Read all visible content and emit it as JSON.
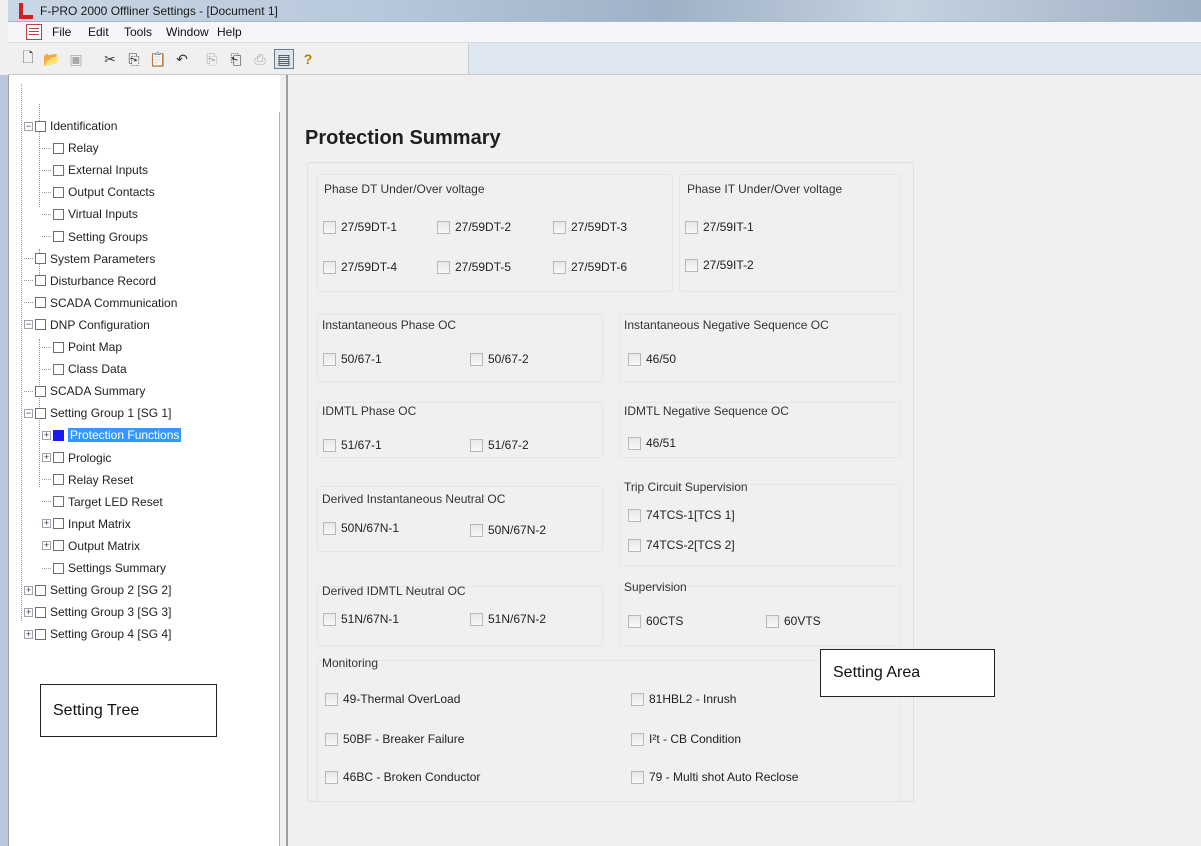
{
  "window": {
    "title": "F-PRO 2000 Offliner Settings - [Document 1]",
    "accent": "#d02020"
  },
  "menu": [
    "File",
    "Edit",
    "Tools",
    "Window",
    "Help"
  ],
  "toolbar": {
    "buttons": [
      "new-icon",
      "open-icon",
      "save-icon",
      "cut-icon",
      "copy-icon",
      "paste-icon",
      "undo-icon",
      "copy-disabled-icon",
      "compare-icon",
      "print-icon",
      "view-toggle-icon",
      "help-icon"
    ]
  },
  "tree": {
    "items": [
      {
        "label": "Identification",
        "level": 0,
        "expander": "minus"
      },
      {
        "label": "Relay",
        "level": 1
      },
      {
        "label": "External Inputs",
        "level": 1
      },
      {
        "label": "Output Contacts",
        "level": 1
      },
      {
        "label": "Virtual Inputs",
        "level": 1
      },
      {
        "label": "Setting Groups",
        "level": 1
      },
      {
        "label": "System Parameters",
        "level": 0
      },
      {
        "label": "Disturbance Record",
        "level": 0
      },
      {
        "label": "SCADA Communication",
        "level": 0
      },
      {
        "label": "DNP Configuration",
        "level": 0,
        "expander": "minus"
      },
      {
        "label": "Point Map",
        "level": 1
      },
      {
        "label": "Class Data",
        "level": 1
      },
      {
        "label": "SCADA Summary",
        "level": 0
      },
      {
        "label": "Setting Group 1 [SG 1]",
        "level": 0,
        "expander": "minus"
      },
      {
        "label": "Protection Functions",
        "level": 1,
        "expander": "plus",
        "selected": true
      },
      {
        "label": "Prologic",
        "level": 1,
        "expander": "plus"
      },
      {
        "label": "Relay Reset",
        "level": 1
      },
      {
        "label": "Target LED Reset",
        "level": 1
      },
      {
        "label": "Input Matrix",
        "level": 1,
        "expander": "plus"
      },
      {
        "label": "Output Matrix",
        "level": 1,
        "expander": "plus"
      },
      {
        "label": "Settings Summary",
        "level": 1
      },
      {
        "label": "Setting Group 2 [SG 2]",
        "level": 0,
        "expander": "plus"
      },
      {
        "label": "Setting Group 3 [SG 3]",
        "level": 0,
        "expander": "plus"
      },
      {
        "label": "Setting Group 4 [SG 4]",
        "level": 0,
        "expander": "plus"
      }
    ],
    "selected_color": "#3399ff"
  },
  "main": {
    "title": "Protection Summary",
    "groups": {
      "phase_dt": {
        "title": "Phase DT Under/Over voltage",
        "items": [
          "27/59DT-1",
          "27/59DT-2",
          "27/59DT-3",
          "27/59DT-4",
          "27/59DT-5",
          "27/59DT-6"
        ]
      },
      "phase_it": {
        "title": "Phase IT Under/Over voltage",
        "items": [
          "27/59IT-1",
          "27/59IT-2"
        ]
      },
      "inst_phase": {
        "title": "Instantaneous Phase OC",
        "items": [
          "50/67-1",
          "50/67-2"
        ]
      },
      "inst_neg": {
        "title": "Instantaneous Negative Sequence OC",
        "items": [
          "46/50"
        ]
      },
      "idmtl_phase": {
        "title": "IDMTL Phase OC",
        "items": [
          "51/67-1",
          "51/67-2"
        ]
      },
      "idmtl_neg": {
        "title": "IDMTL Negative Sequence OC",
        "items": [
          "46/51"
        ]
      },
      "derived_inst": {
        "title": "Derived Instantaneous Neutral OC",
        "items": [
          "50N/67N-1",
          "50N/67N-2"
        ]
      },
      "trip_circuit": {
        "title": "Trip Circuit Supervision",
        "items": [
          "74TCS-1[TCS 1]",
          "74TCS-2[TCS 2]"
        ]
      },
      "derived_idmtl": {
        "title": "Derived IDMTL Neutral OC",
        "items": [
          "51N/67N-1",
          "51N/67N-2"
        ]
      },
      "supervision": {
        "title": "Supervision",
        "items": [
          "60CTS",
          "60VTS"
        ]
      },
      "monitoring": {
        "title": "Monitoring",
        "items": [
          "49-Thermal OverLoad",
          "81HBL2 - Inrush",
          "50BF - Breaker Failure",
          "I²t - CB Condition",
          "46BC - Broken Conductor",
          "79 - Multi shot Auto Reclose"
        ]
      }
    }
  },
  "annotations": {
    "setting_tree": "Setting Tree",
    "setting_area": "Setting Area"
  }
}
